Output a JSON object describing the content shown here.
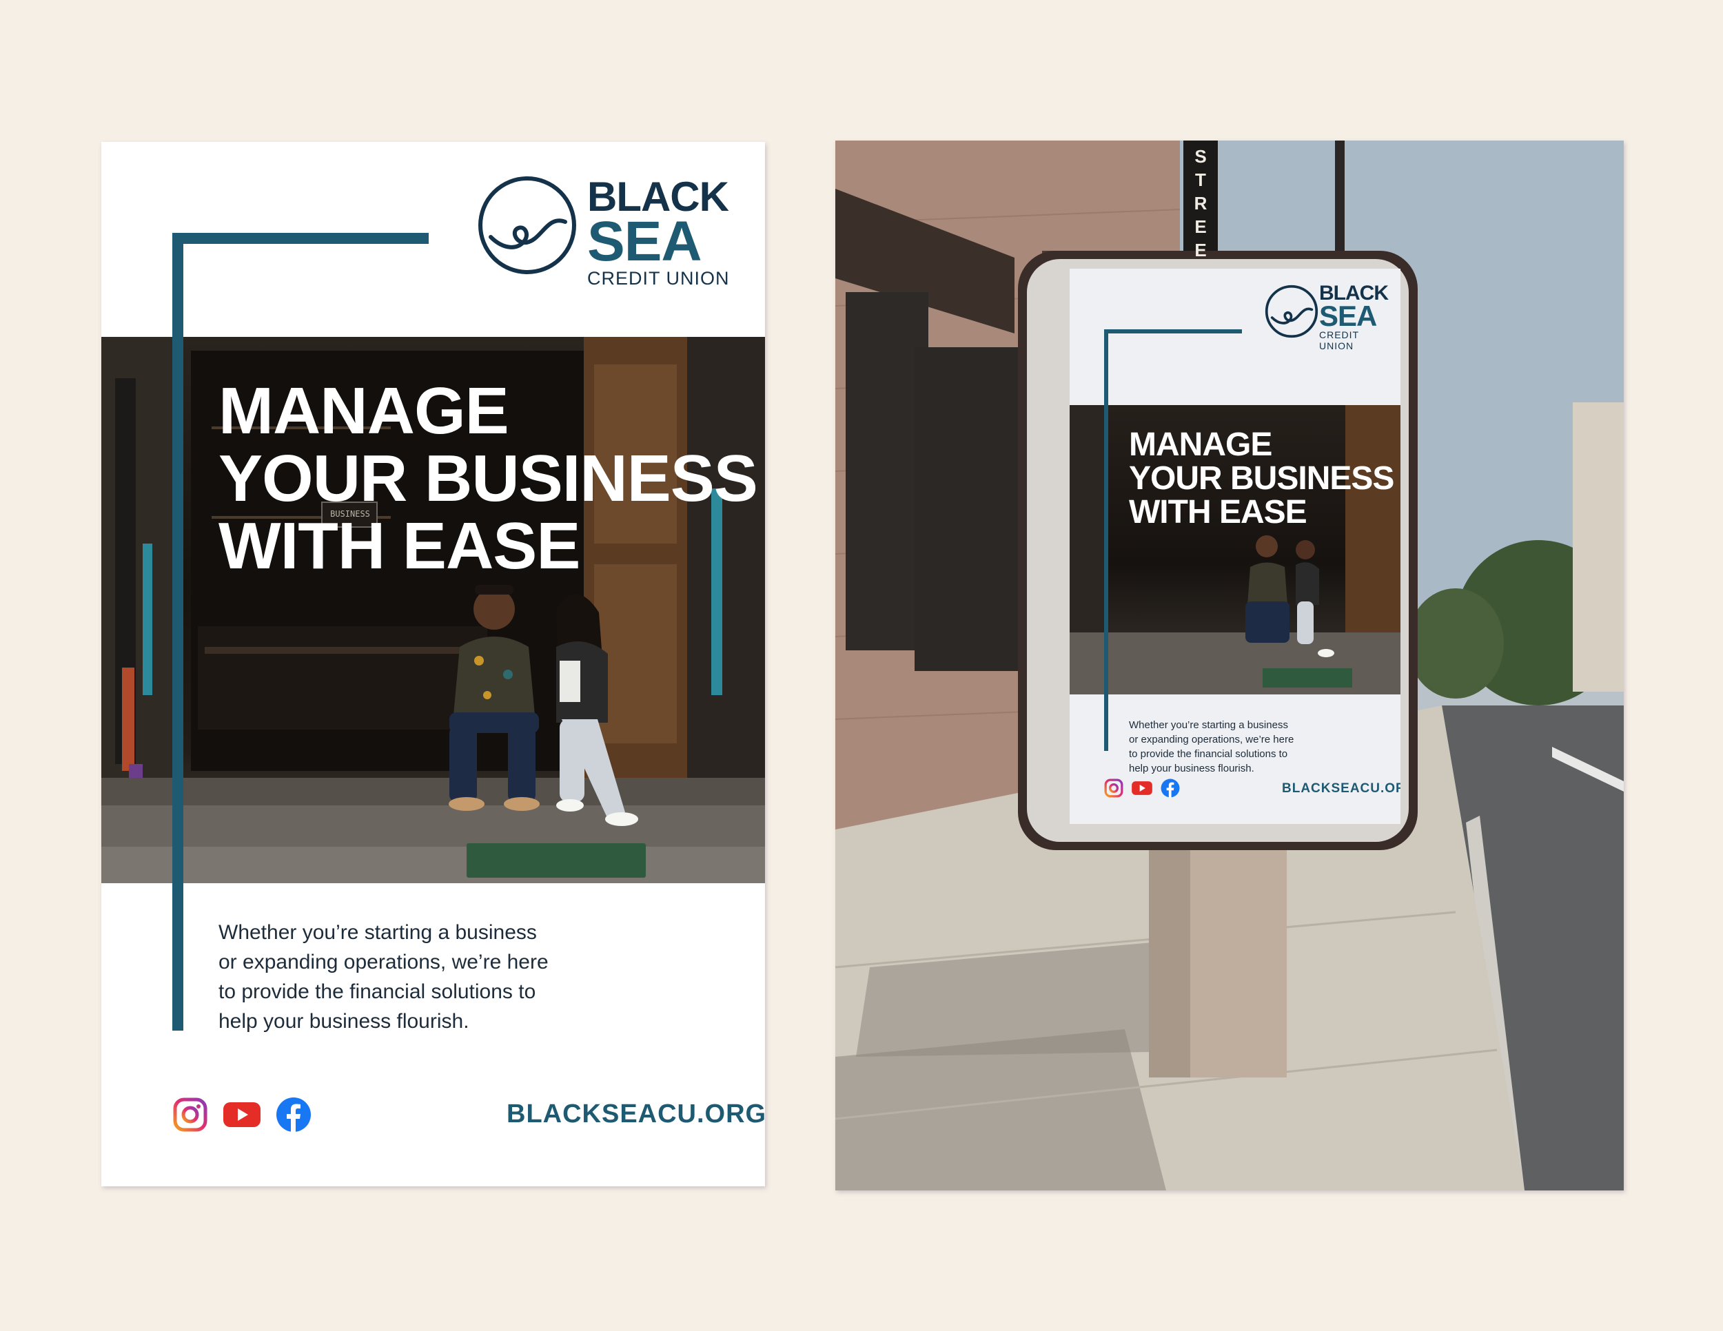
{
  "poster": {
    "brand": {
      "word1": "BLACK",
      "word2": "SEA",
      "subline": "CREDIT UNION",
      "logo_icon": "wave-in-circle-icon"
    },
    "headline": [
      "MANAGE",
      "YOUR BUSINESS",
      "WITH EASE"
    ],
    "photo_sign": "BUSINESS",
    "body_lines": [
      "Whether you’re starting a business",
      "or expanding operations, we’re here",
      "to provide the financial solutions to",
      "help your business flourish."
    ],
    "social_icons": [
      "instagram-icon",
      "youtube-icon",
      "facebook-icon"
    ],
    "url": "BLACKSEACU.ORG"
  },
  "mockup": {
    "street_sign": "STREE"
  },
  "colors": {
    "background": "#f6efe5",
    "brand_navy": "#14324a",
    "brand_teal": "#1f5a73",
    "text": "#1d2c3a"
  }
}
